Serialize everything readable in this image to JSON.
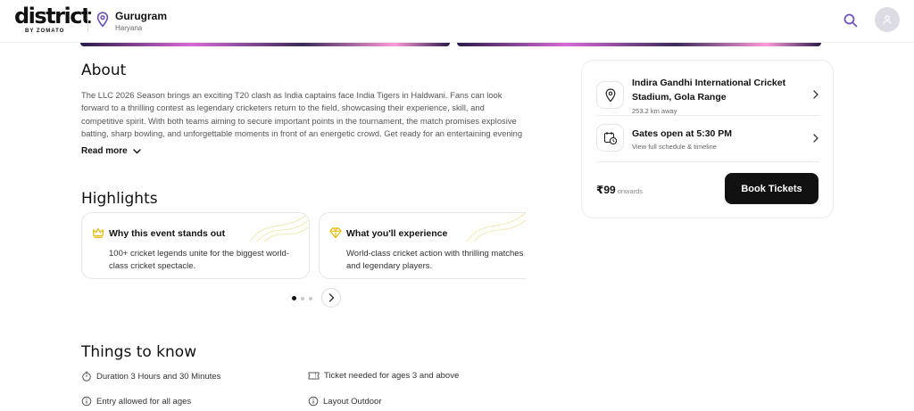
{
  "header": {
    "logo": {
      "main": "district",
      "sub": "BY ZOMATO"
    },
    "location": {
      "city": "Gurugram",
      "state": "Haryana"
    },
    "icons": {
      "location": "location-pin-icon",
      "search": "search-icon",
      "avatar": "user-icon"
    }
  },
  "about": {
    "title": "About",
    "text": "The LLC 2026 Season brings an exciting T20 clash as India captains face India Tigers in Haldwani. Fans can look forward to a thrilling contest as legendary cricketers return to the field, showcasing their experience, skill, and competitive spirit. With both teams aiming to secure important points in the tournament, the match promises explosive batting, sharp bowling, and unforgettable moments in front of an energetic crowd. Get ready for an entertaining evening of cricket a...",
    "read_more": "Read more"
  },
  "highlights": {
    "title": "Highlights",
    "cards": [
      {
        "title": "Why this event stands out",
        "text": "100+ cricket legends unite for the biggest world-class cricket spectacle.",
        "icon": "crown-icon"
      },
      {
        "title": "What you'll experience",
        "text": "World-class cricket action with thrilling matches and legendary players.",
        "icon": "diamond-icon"
      }
    ],
    "pagination": {
      "current": 1,
      "total": 3
    }
  },
  "things_to_know": {
    "title": "Things to know",
    "items": [
      {
        "text": "Duration 3 Hours and 30 Minutes",
        "icon": "stopwatch-icon"
      },
      {
        "text": "Ticket needed for ages 3 and above",
        "icon": "ticket-icon"
      },
      {
        "text": "Entry allowed for all ages",
        "icon": "info-icon"
      },
      {
        "text": "Layout Outdoor",
        "icon": "info-icon"
      }
    ]
  },
  "booking": {
    "venue": {
      "title": "Indira Gandhi International Cricket Stadium, Gola Range",
      "distance": "253.2 km away",
      "icon": "location-pin-icon"
    },
    "gates": {
      "title": "Gates open at 5:30 PM",
      "subtitle": "View full schedule & timeline",
      "icon": "calendar-clock-icon"
    },
    "price": "₹99",
    "price_suffix": "onwards",
    "cta": "Book Tickets"
  },
  "colors": {
    "accent": "#6b4fbb",
    "button": "#111111",
    "highlight_icon": "#e5b800"
  }
}
